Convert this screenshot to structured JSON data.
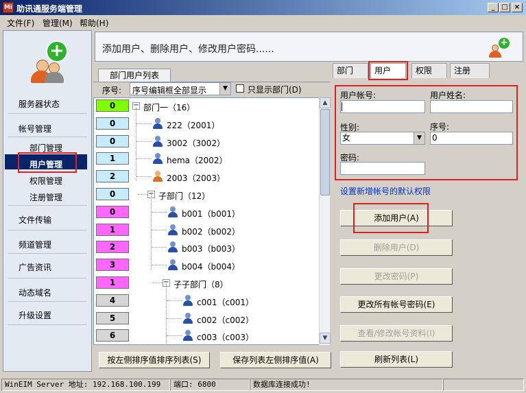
{
  "window": {
    "title": "助讯通服务端管理",
    "app_icon": "Mi"
  },
  "menu": {
    "file": "文件(F)",
    "manage": "管理(M)",
    "help": "帮助(H)"
  },
  "sidebar": {
    "items": [
      {
        "label": "服务器状态"
      },
      {
        "label": "帐号管理"
      },
      {
        "label": "部门管理"
      },
      {
        "label": "用户管理"
      },
      {
        "label": "权限管理"
      },
      {
        "label": "注册管理"
      },
      {
        "label": "文件传输"
      },
      {
        "label": "频道管理"
      },
      {
        "label": "广告资讯"
      },
      {
        "label": "动态域名"
      },
      {
        "label": "升级设置"
      }
    ]
  },
  "banner": {
    "text": "添加用户、删除用户、修改用户密码......"
  },
  "list_panel": {
    "tab_title": "部门用户列表",
    "sort_label": "序号:",
    "sort_value": "序号编辑框全部显示",
    "only_dept_label": "只显示部门(D)",
    "badges": [
      {
        "value": "0",
        "color": "#80ff00"
      },
      {
        "value": "0",
        "color": "#c6ecfc"
      },
      {
        "value": "0",
        "color": "#c6ecfc"
      },
      {
        "value": "1",
        "color": "#c6ecfc"
      },
      {
        "value": "2",
        "color": "#c6ecfc"
      },
      {
        "value": "0",
        "color": "#c6ecfc"
      },
      {
        "value": "0",
        "color": "#ff66ff"
      },
      {
        "value": "1",
        "color": "#ff66ff"
      },
      {
        "value": "2",
        "color": "#ff66ff"
      },
      {
        "value": "3",
        "color": "#ff66ff"
      },
      {
        "value": "1",
        "color": "#ff66ff"
      },
      {
        "value": "4",
        "color": "#d6d6d6"
      },
      {
        "value": "5",
        "color": "#d6d6d6"
      },
      {
        "value": "6",
        "color": "#d6d6d6"
      }
    ],
    "tree": [
      {
        "label": "部门一（16）",
        "type": "dept"
      },
      {
        "label": "222（2001）",
        "type": "user-blue"
      },
      {
        "label": "3002（3002）",
        "type": "user-blue"
      },
      {
        "label": "hema（2002）",
        "type": "user-blue"
      },
      {
        "label": "2003（2003）",
        "type": "user-orange"
      },
      {
        "label": "子部门（12）",
        "type": "dept"
      },
      {
        "label": "b001（b001）",
        "type": "user-blue"
      },
      {
        "label": "b002（b002）",
        "type": "user-blue"
      },
      {
        "label": "b003（b003）",
        "type": "user-blue"
      },
      {
        "label": "b004（b004）",
        "type": "user-blue"
      },
      {
        "label": "子子部门（8）",
        "type": "dept"
      },
      {
        "label": "c001（c001）",
        "type": "user-blue"
      },
      {
        "label": "c002（c002）",
        "type": "user-blue"
      },
      {
        "label": "c003（c003）",
        "type": "user-blue"
      }
    ],
    "btn_sort_by_left": "按左侧排序值排序列表(S)",
    "btn_save_left_sort": "保存列表左侧排序值(A)"
  },
  "right_panel": {
    "tabs": [
      "部门",
      "用户",
      "权限",
      "注册"
    ],
    "account_label": "用户帐号:",
    "account_value": "",
    "name_label": "用户姓名:",
    "name_value": "",
    "gender_label": "性别:",
    "gender_value": "女",
    "seq_label": "序号:",
    "seq_value": "0",
    "password_label": "密码:",
    "password_value": "",
    "default_perm_link": "设置新增帐号的默认权限",
    "btn_add": "添加用户(A)",
    "btn_delete": "删除用户(D)",
    "btn_change_pwd": "更改密码(P)",
    "btn_change_all_pwd": "更改所有帐号密码(E)",
    "btn_view_edit": "查看/修改帐号资料(I)",
    "btn_refresh": "刷新列表(L)"
  },
  "status": {
    "server": "WinEIM Server 地址: 192.168.100.199",
    "port": "端口: 6800",
    "db": "数据库连接成功!"
  }
}
